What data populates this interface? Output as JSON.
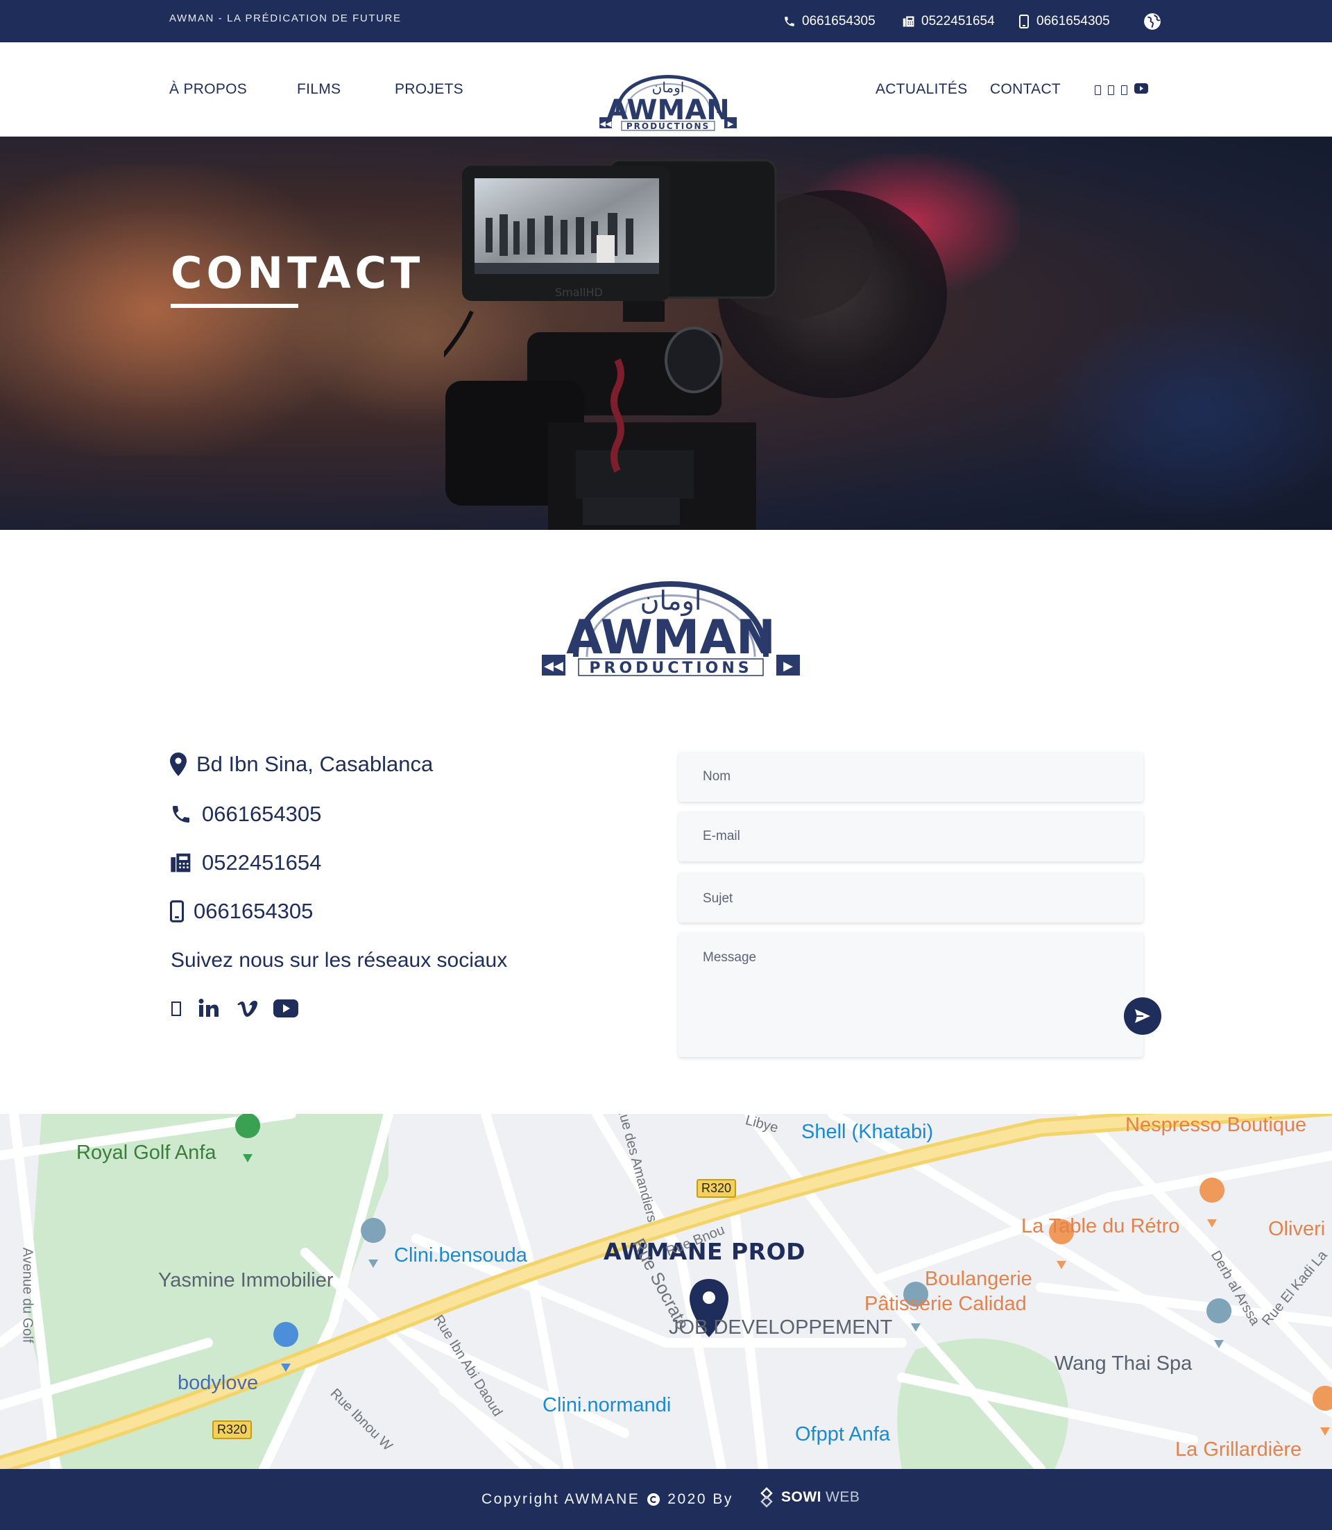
{
  "topbar": {
    "tagline": "AWMAN - LA PRÉDICATION DE FUTURE",
    "phone": "0661654305",
    "fax": "0522451654",
    "mobile": "0661654305"
  },
  "nav": {
    "left": [
      "À PROPOS",
      "FILMS",
      "PROJETS"
    ],
    "right": [
      "ACTUALITÉS",
      "CONTACT"
    ],
    "logo_text": "AWMAN",
    "logo_sub": "PRODUCTIONS"
  },
  "hero": {
    "title": "CONTACT"
  },
  "logo_big": {
    "text": "AWMAN",
    "sub": "PRODUCTIONS"
  },
  "contact_info": {
    "address": "Bd Ibn Sina, Casablanca",
    "phone": "0661654305",
    "fax": "0522451654",
    "mobile": "0661654305",
    "follow_text": "Suivez nous sur les réseaux sociaux"
  },
  "form": {
    "name_placeholder": "Nom",
    "email_placeholder": "E-mail",
    "subject_placeholder": "Sujet",
    "message_placeholder": "Message"
  },
  "map": {
    "marker_title": "AWMANE PROD",
    "labels": {
      "royal_golf": "Royal Golf Anfa",
      "yasmine": "Yasmine Immobilier",
      "bodylove": "bodylove",
      "clini_bensouda": "Clini.bensouda",
      "clini_normandi": "Clini.normandi",
      "shell": "Shell (Khatabi)",
      "nespresso": "Nespresso Boutique",
      "la_table": "La Table du Rétro",
      "oliveri": "Oliveri",
      "boulangerie": "Boulangerie",
      "patisserie": "Pâtisserie Calidad",
      "job_dev": "JOB DEVELOPPEMENT",
      "wang_thai": "Wang Thai Spa",
      "ofppt": "Ofppt Anfa",
      "la_grillardiere": "La Grillardière",
      "avenue_golf": "Avenue du Golf",
      "amandiers": "Rue des Amandiers",
      "rue_socrate": "Rue Socrate",
      "rue_ibn_abi_daoud": "Rue Ibn Abi Daoud",
      "rue_ibnou": "Rue Ibnou W",
      "rue_bnou": "Rue Bnou",
      "derb_arssa": "Derb al Arssa",
      "rue_el_kadi": "Rue El Kadi La",
      "libye": "Libye",
      "r320_a": "R320",
      "r320_b": "R320"
    }
  },
  "footer": {
    "copyright": "Copyright AWMANE",
    "year_by": "2020 By",
    "brand_a": "SOWI",
    "brand_b": "WEB"
  },
  "colors": {
    "navy": "#1f2d5a",
    "white": "#ffffff"
  }
}
